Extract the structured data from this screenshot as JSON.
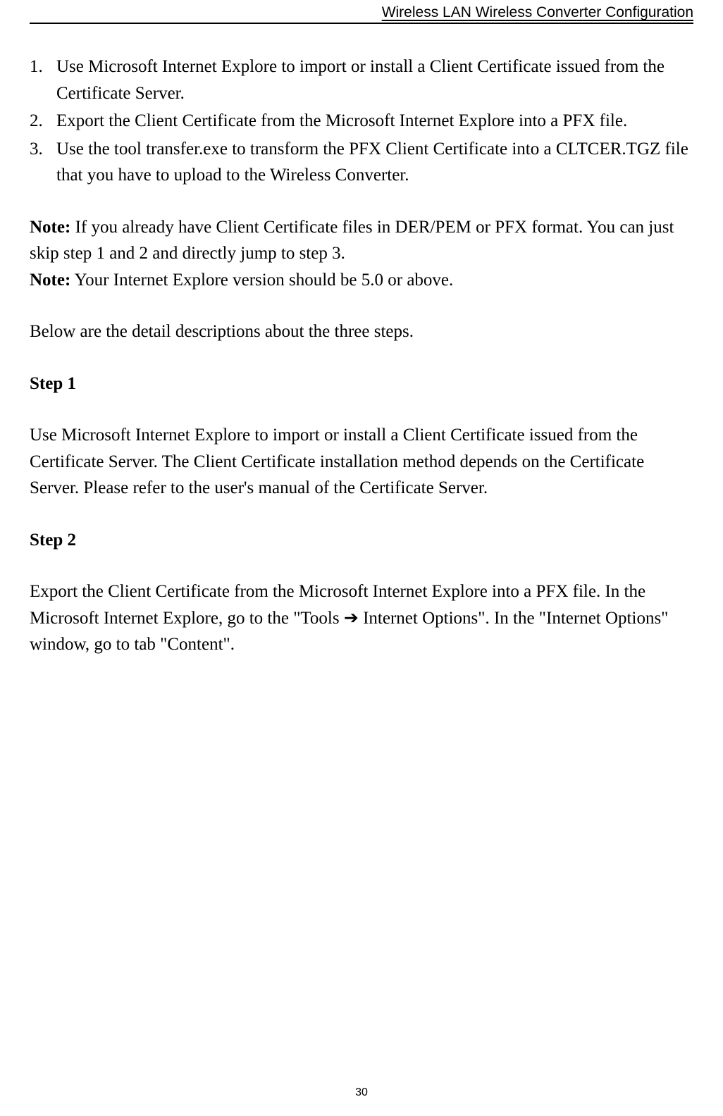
{
  "header": {
    "title": "Wireless LAN Wireless Converter Configuration"
  },
  "list": {
    "items": [
      "Use Microsoft Internet Explore to import or install a Client Certificate issued from the Certificate Server.",
      "Export the Client Certificate from the Microsoft Internet Explore into a PFX file.",
      "Use the tool transfer.exe to transform the PFX Client Certificate into a CLTCER.TGZ file that you have to upload to the Wireless Converter."
    ]
  },
  "notes": {
    "note1_label": "Note:",
    "note1_text": " If you already have Client Certificate files in DER/PEM or PFX format. You can just skip step 1 and 2 and directly jump to step 3.",
    "note2_label": "Note:",
    "note2_text": " Your Internet Explore version should be 5.0 or above."
  },
  "intro": "Below are the detail descriptions about the three steps.",
  "step1": {
    "heading": "Step 1",
    "text": "Use Microsoft Internet Explore to import or install a Client Certificate issued from the Certificate Server. The Client Certificate installation method depends on the Certificate Server. Please refer to the user's manual of the Certificate Server."
  },
  "step2": {
    "heading": "Step 2",
    "text_before_arrow": "Export the Client Certificate from the Microsoft Internet Explore into a PFX file. In the Microsoft Internet Explore, go to the \"Tools ",
    "arrow": "➔",
    "text_after_arrow": " Internet Options\". In the \"Internet Options\" window, go to tab \"Content\"."
  },
  "pageNumber": "30"
}
